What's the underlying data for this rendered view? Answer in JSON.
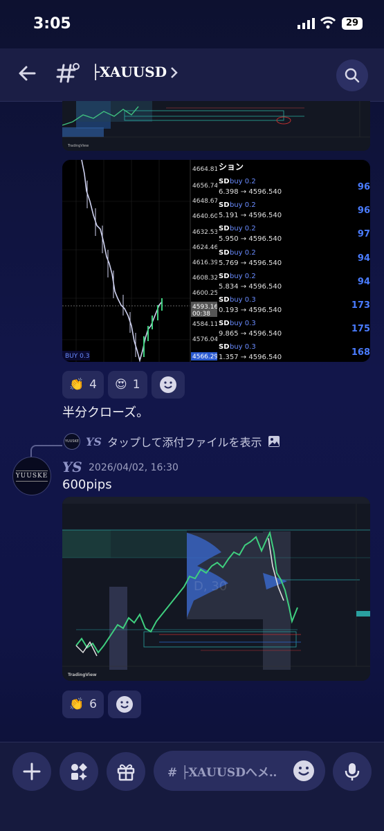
{
  "status_bar": {
    "time": "3:05",
    "battery": "29"
  },
  "header": {
    "channel_name": "├XAUUSD"
  },
  "image2": {
    "prices": [
      "4664.810",
      "4656.740",
      "4648.670",
      "4640.600",
      "4632.530",
      "4624.460",
      "4616.390",
      "4608.320",
      "4600.250",
      "4593.169",
      "4584.110",
      "4576.040",
      "4566.295"
    ],
    "countdown": "00:38",
    "positions_header": "ション",
    "positions": [
      {
        "side": "buy 0.2",
        "line": "6.398 → 4596.540",
        "profit": "96"
      },
      {
        "side": "buy 0.2",
        "line": "5.191 → 4596.540",
        "profit": "96"
      },
      {
        "side": "buy 0.2",
        "line": "5.950 → 4596.540",
        "profit": "97"
      },
      {
        "side": "buy 0.2",
        "line": "5.769 → 4596.540",
        "profit": "94"
      },
      {
        "side": "buy 0.2",
        "line": "5.834 → 4596.540",
        "profit": "94"
      },
      {
        "side": "buy 0.3",
        "line": "0.193 → 4596.540",
        "profit": "173"
      },
      {
        "side": "buy 0.3",
        "line": "9.865 → 4596.540",
        "profit": "175"
      },
      {
        "side": "buy 0.3",
        "line": "1.357 → 4596.540",
        "profit": "168"
      }
    ],
    "footer_label": "BUY 0.3"
  },
  "reactions1": [
    {
      "emoji": "👏",
      "count": "4"
    },
    {
      "emoji": "😍",
      "count": "1"
    }
  ],
  "message1": "半分クローズ。",
  "reply": {
    "author": "YS",
    "text": "タップして添付ファイルを表示"
  },
  "message2": {
    "avatar_text": "YUUSKE",
    "author": "YS",
    "timestamp": "2026/04/02, 16:30",
    "text": "600pips"
  },
  "chart_watermark": "D, 30",
  "tradingview_label": "TradingView",
  "reactions2": [
    {
      "emoji": "👏",
      "count": "6"
    }
  ],
  "composer": {
    "placeholder": "# ├XAUUSDへメ‥"
  }
}
